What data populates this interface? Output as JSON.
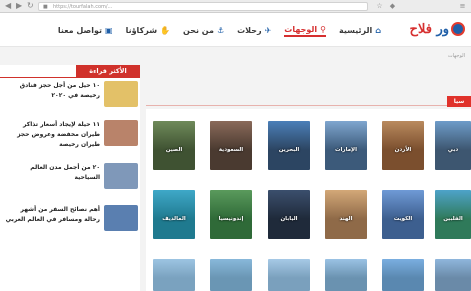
{
  "browser": {
    "url": "https://tourfalah.com/...",
    "back_icon": "back-arrow-icon",
    "forward_icon": "forward-arrow-icon"
  },
  "header": {
    "logo": {
      "part1": "ور",
      "part2": " فلاح"
    },
    "nav": [
      {
        "label": "الرئيسية",
        "icon": "home-icon",
        "glyph": "⌂",
        "active": false
      },
      {
        "label": "الوجهات",
        "icon": "location-pin-icon",
        "glyph": "⚲",
        "active": true
      },
      {
        "label": "رحلات",
        "icon": "plane-icon",
        "glyph": "✈",
        "active": false
      },
      {
        "label": "من نحن",
        "icon": "anchor-icon",
        "glyph": "⚓",
        "active": false
      },
      {
        "label": "شركاؤنا",
        "icon": "handshake-icon",
        "glyph": "✋",
        "active": false
      },
      {
        "label": "تواصل معنا",
        "icon": "contact-card-icon",
        "glyph": "▣",
        "active": false
      }
    ]
  },
  "breadcrumb": "الوجهات",
  "section_tab": "سيا",
  "sidebar": {
    "title": "الأكثر قراءة",
    "items": [
      {
        "text": "١٠ حيل من أجل حجز فنادق رخيصة في ٢٠٢٠",
        "thumb": "#e3c168"
      },
      {
        "text": "١١ حيلة لإيجاد أسعار تذاكر طيران مخفضة وعروض حجز طيران رخيصة",
        "thumb": "#b9836a"
      },
      {
        "text": "٢٠ من أجمل مدن العالم السياحية",
        "thumb": "#7f98b9"
      },
      {
        "text": "أهم نصائح السفر من أشهر رحالة ومسافر في العالم العربي",
        "thumb": "#5a7fb0"
      }
    ]
  },
  "destinations_row1": [
    {
      "name": "دبي",
      "sky": "#6e9cc9",
      "ground": "#3d5670"
    },
    {
      "name": "الأردن",
      "sky": "#b98a5e",
      "ground": "#7b4f2e"
    },
    {
      "name": "الإمارات",
      "sky": "#7fa6cf",
      "ground": "#3c5a7a"
    },
    {
      "name": "البحرين",
      "sky": "#4b7fb8",
      "ground": "#2c4562"
    },
    {
      "name": "السعودية",
      "sky": "#8a6a5a",
      "ground": "#4a3a30"
    },
    {
      "name": "الصين",
      "sky": "#6f8a5a",
      "ground": "#3f5232"
    }
  ],
  "destinations_row2": [
    {
      "name": "الفلبين",
      "sky": "#4ea3c9",
      "ground": "#2f7a5a"
    },
    {
      "name": "الكويت",
      "sky": "#6f9ad6",
      "ground": "#3d5f8f"
    },
    {
      "name": "الهند",
      "sky": "#d3a878",
      "ground": "#8f6a48"
    },
    {
      "name": "اليابان",
      "sky": "#3b4f6d",
      "ground": "#1f2a3a"
    },
    {
      "name": "إندونيسيا",
      "sky": "#5a9a5c",
      "ground": "#2f6a38"
    },
    {
      "name": "المالديف",
      "sky": "#3fa8c8",
      "ground": "#1f7a8f"
    }
  ],
  "destinations_row3": [
    {
      "name": "",
      "sky": "#8fb6dc",
      "ground": "#6a8aa8"
    },
    {
      "name": "",
      "sky": "#7aaee0",
      "ground": "#5a88b0"
    },
    {
      "name": "",
      "sky": "#9ac2e4",
      "ground": "#6a92b0"
    },
    {
      "name": "",
      "sky": "#a6c9e6",
      "ground": "#7aa0bd"
    },
    {
      "name": "",
      "sky": "#88b8da",
      "ground": "#6a96b4"
    },
    {
      "name": "",
      "sky": "#9cc4e2",
      "ground": "#7aa2bf"
    }
  ],
  "colors": {
    "brand_blue": "#1f5fa8",
    "brand_red": "#d62f2f"
  }
}
